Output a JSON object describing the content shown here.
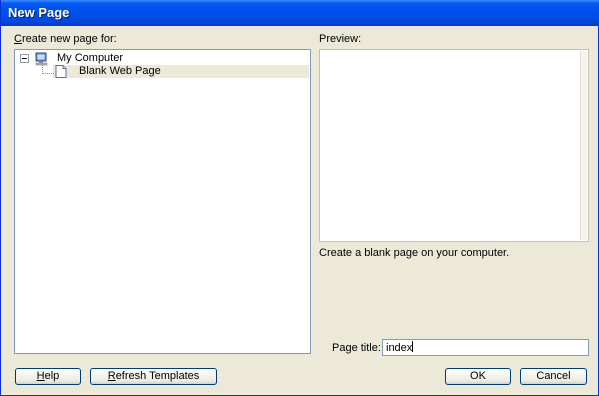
{
  "window": {
    "title": "New Page"
  },
  "left_panel": {
    "label_accel": "C",
    "label_rest": "reate new page for:",
    "tree": [
      {
        "label": "My Computer",
        "icon": "computer-icon",
        "expanded": true,
        "expander": "−"
      },
      {
        "label": "Blank Web Page",
        "icon": "page-icon",
        "selected": true
      }
    ]
  },
  "right_panel": {
    "preview_label": "Preview:",
    "description": "Create a blank page on your computer.",
    "page_title_label": "Page title:",
    "page_title_value": "index"
  },
  "buttons": {
    "help_accel": "H",
    "help_rest": "elp",
    "refresh_accel": "R",
    "refresh_rest": "efresh Templates",
    "ok": "OK",
    "cancel": "Cancel"
  },
  "colors": {
    "titlebar": "#0053ee",
    "dialog_bg": "#ece9d8",
    "button_border": "#003c74",
    "field_border": "#7f9db9"
  }
}
